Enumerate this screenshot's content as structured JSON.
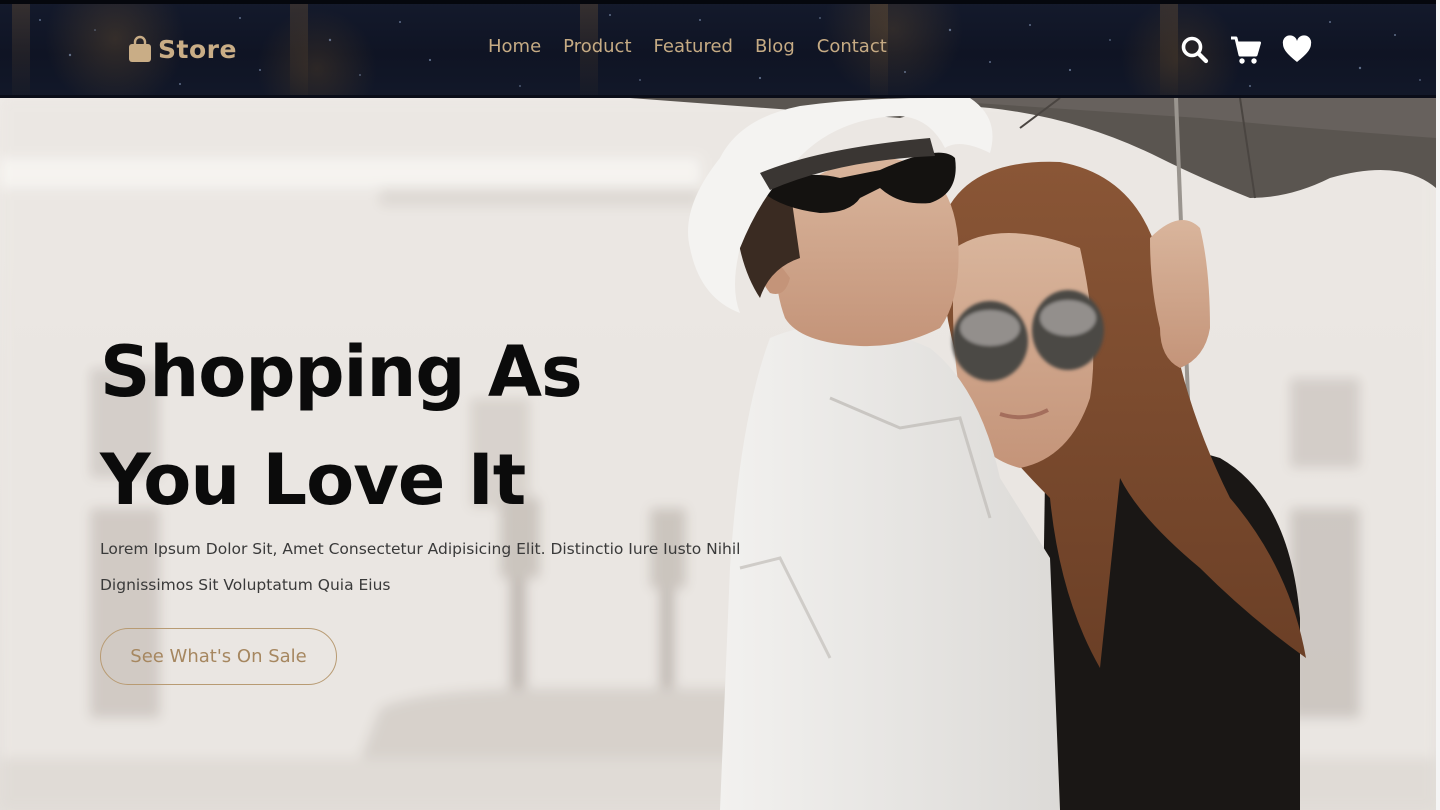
{
  "header": {
    "brand": {
      "icon": "shopping-bag-icon",
      "name": "Store"
    },
    "nav": [
      {
        "label": "Home"
      },
      {
        "label": "Product"
      },
      {
        "label": "Featured"
      },
      {
        "label": "Blog"
      },
      {
        "label": "Contact"
      }
    ],
    "actions": [
      "search-icon",
      "cart-icon",
      "heart-icon"
    ]
  },
  "hero": {
    "title_line1": "Shopping As",
    "title_line2": "You Love It",
    "subtitle_line1": "Lorem Ipsum Dolor Sit, Amet Consectetur Adipisicing Elit. Distinctio Iure Iusto Nihil",
    "subtitle_line2": "Dignissimos Sit Voluptatum Quia Eius",
    "cta_label": "See What's On Sale",
    "image": "couple-under-umbrella-photo"
  },
  "colors": {
    "accent": "#c6ab84",
    "header_bg": "#11172a",
    "headline": "#0b0b0b",
    "cta_border": "#b89b73"
  }
}
